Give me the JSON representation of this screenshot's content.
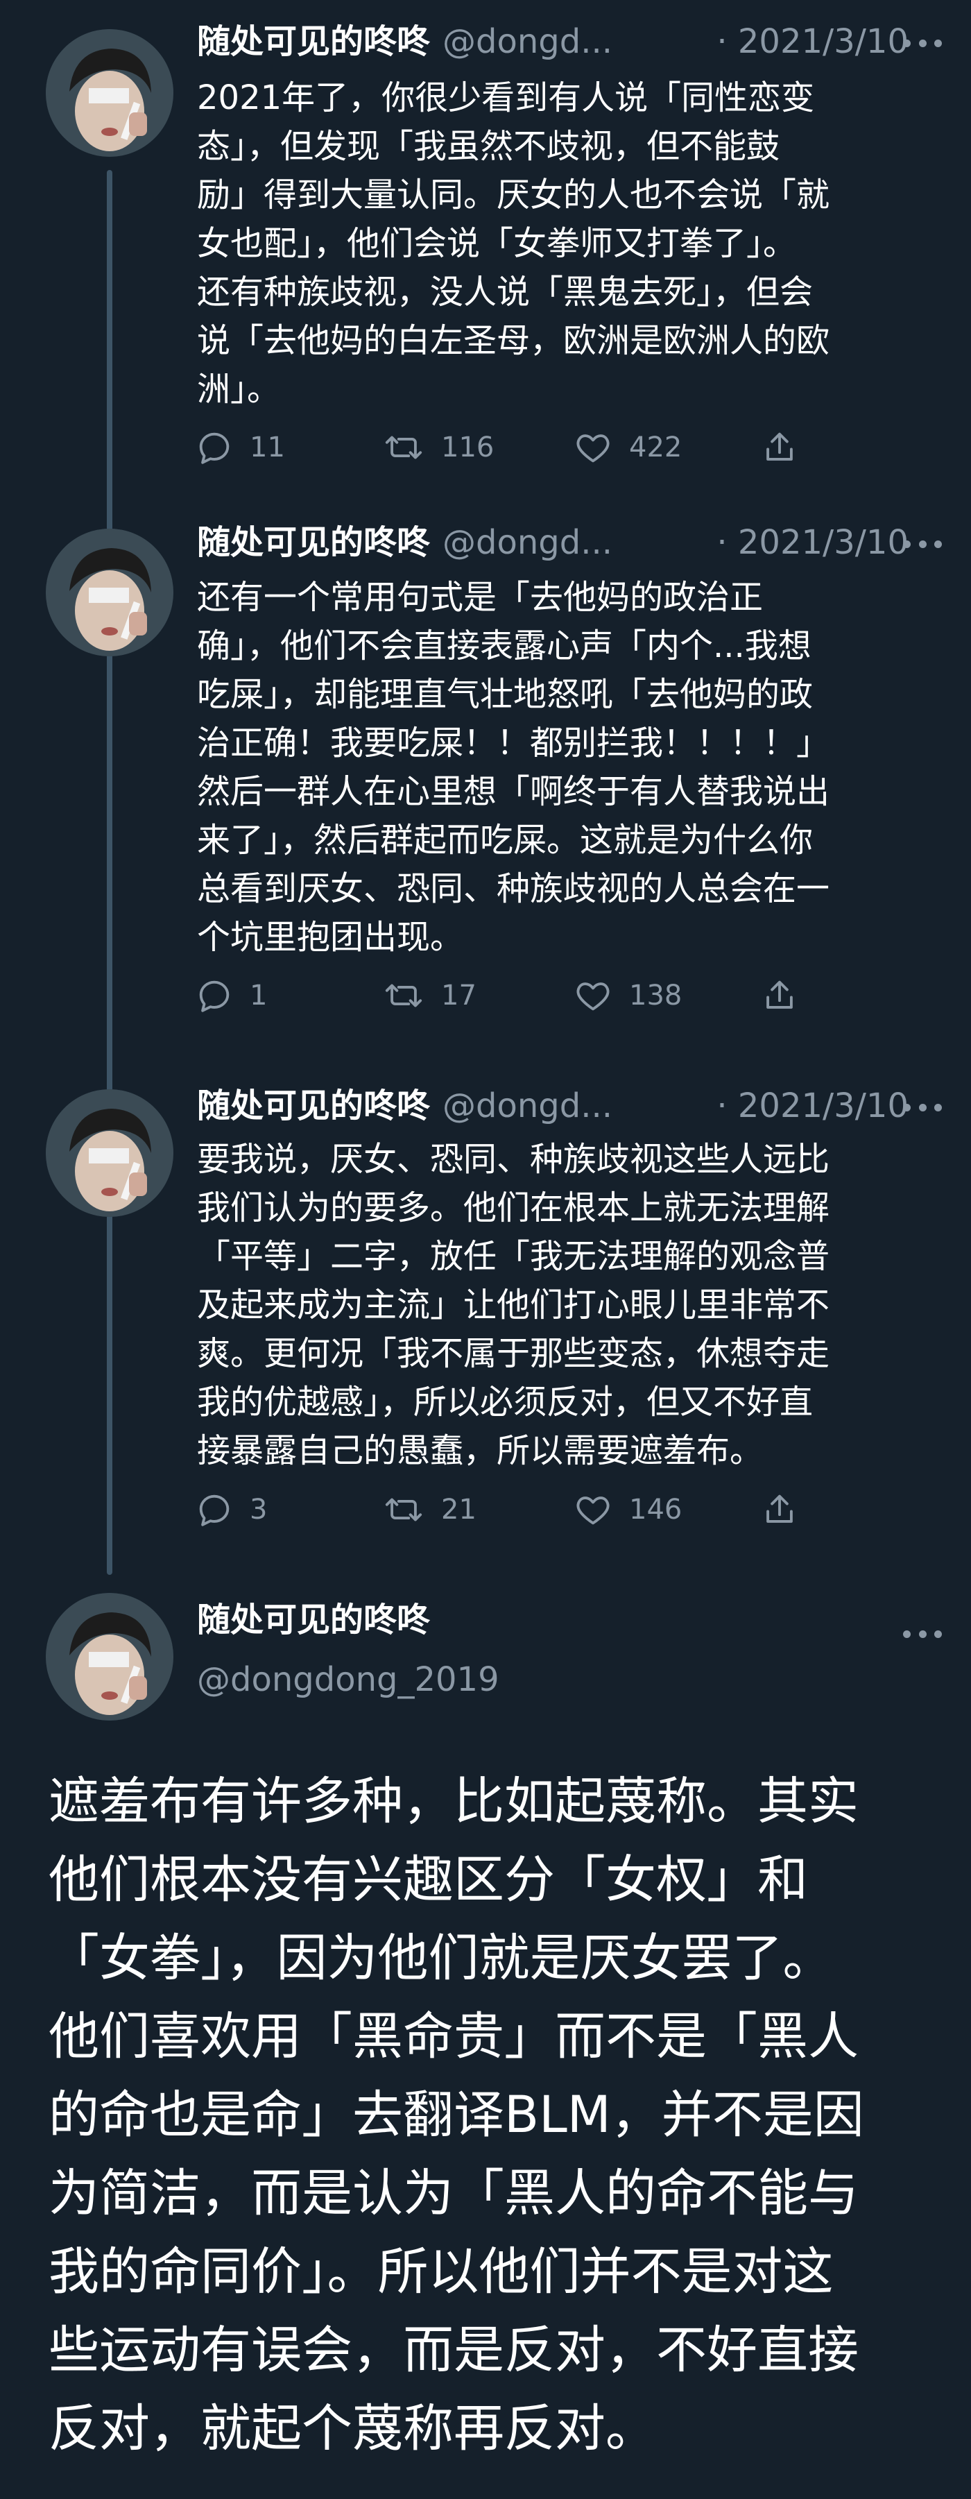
{
  "tweets": [
    {
      "display_name": "随处可见的咚咚",
      "handle": "@dongd...",
      "separator": "·",
      "date": "2021/3/10",
      "text": "2021年了，你很少看到有人说「同性恋变\n态」，但发现「我虽然不歧视，但不能鼓\n励」得到大量认同。厌女的人也不会说「就\n女也配」，他们会说「女拳师又打拳了」。\n还有种族歧视，没人说「黑鬼去死」，但会\n说「去他妈的白左圣母，欧洲是欧洲人的欧\n洲」。",
      "replies": "11",
      "retweets": "116",
      "likes": "422"
    },
    {
      "display_name": "随处可见的咚咚",
      "handle": "@dongd...",
      "separator": "·",
      "date": "2021/3/10",
      "text": "还有一个常用句式是「去他妈的政治正\n确」，他们不会直接表露心声「内个...我想\n吃屎」，却能理直气壮地怒吼「去他妈的政\n治正确！我要吃屎！！都别拦我！！！！」\n然后一群人在心里想「啊终于有人替我说出\n来了」，然后群起而吃屎。这就是为什么你\n总看到厌女、恐同、种族歧视的人总会在一\n个坑里抱团出现。",
      "replies": "1",
      "retweets": "17",
      "likes": "138"
    },
    {
      "display_name": "随处可见的咚咚",
      "handle": "@dongd...",
      "separator": "·",
      "date": "2021/3/10",
      "text": "要我说，厌女、恐同、种族歧视这些人远比\n我们认为的要多。他们在根本上就无法理解\n「平等」二字，放任「我无法理解的观念普\n及起来成为主流」让他们打心眼儿里非常不\n爽。更何况「我不属于那些变态，休想夺走\n我的优越感」，所以必须反对，但又不好直\n接暴露自己的愚蠢，所以需要遮羞布。",
      "replies": "3",
      "retweets": "21",
      "likes": "146"
    }
  ],
  "main_tweet": {
    "display_name": "随处可见的咚咚",
    "handle": "@dongdong_2019",
    "text": "遮羞布有许多种，比如起蔑称。其实\n他们根本没有兴趣区分「女权」和\n「女拳」，因为他们就是厌女罢了。\n他们喜欢用「黑命贵」而不是「黑人\n的命也是命」去翻译BLM，并不是因\n为简洁，而是认为「黑人的命不能与\n我的命同价」。所以他们并不是对这\n些运动有误会，而是反对，不好直接\n反对，就起个蔑称再反对。"
  },
  "icons": {
    "reply": "reply-icon",
    "retweet": "retweet-icon",
    "like": "heart-icon",
    "share": "share-icon",
    "more": "more-icon"
  },
  "colors": {
    "background": "#15202b",
    "secondary_text": "#8b98a5",
    "thread_line": "#3d5466"
  }
}
